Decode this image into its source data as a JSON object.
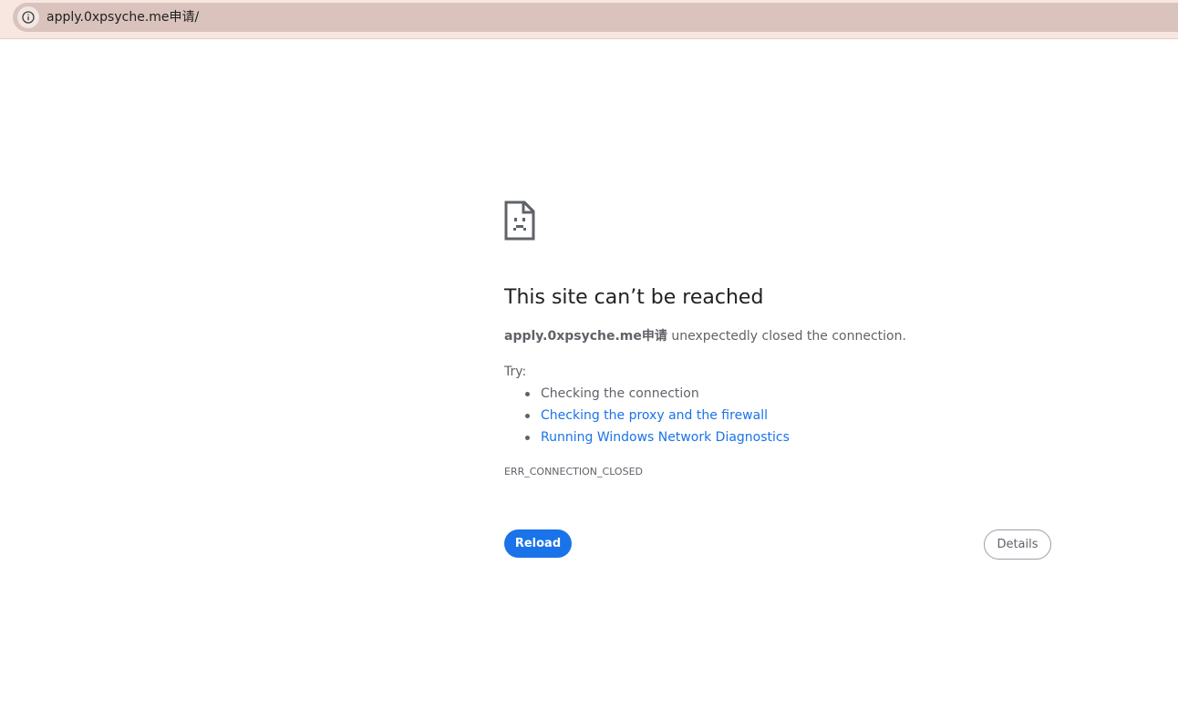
{
  "address_bar": {
    "url": "apply.0xpsyche.me申请/",
    "icon": "info-icon",
    "colors": {
      "bar_background": "#d9c3bc",
      "tab_strip": "#f8e7e0"
    }
  },
  "error_page": {
    "icon": "sad-page-icon",
    "heading": "This site can’t be reached",
    "message": {
      "host": "apply.0xpsyche.me申请",
      "text": " unexpectedly closed the connection."
    },
    "try_label": "Try:",
    "suggestions": [
      {
        "text": "Checking the connection",
        "is_link": false
      },
      {
        "text": "Checking the proxy and the firewall",
        "is_link": true
      },
      {
        "text": "Running Windows Network Diagnostics",
        "is_link": true
      }
    ],
    "error_code": "ERR_CONNECTION_CLOSED",
    "buttons": {
      "reload": "Reload",
      "details": "Details"
    },
    "colors": {
      "link": "#1a73e8",
      "primary_button": "#1a73e8",
      "text": "#5f6368",
      "heading": "#202124"
    }
  }
}
